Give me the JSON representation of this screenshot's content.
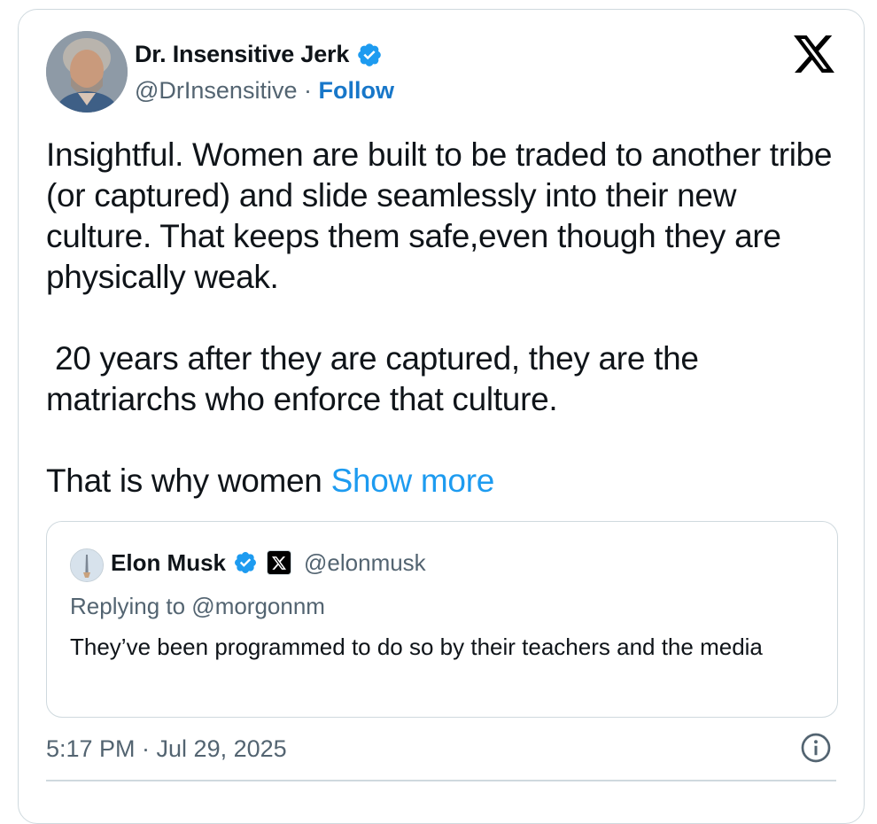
{
  "author": {
    "name": "Dr. Insensitive Jerk",
    "handle": "@DrInsensitive",
    "separator": " · ",
    "follow_label": "Follow",
    "verified_badge_icon": "verified-badge-icon",
    "avatar_icon": "avatar-photo"
  },
  "platform_logo_icon": "x-logo-icon",
  "tweet": {
    "paragraph1": "Insightful. Women are built to be traded to another tribe (or captured) and slide seamlessly into their new culture. That keeps them safe,even though they are physically weak.",
    "paragraph2": " 20 years after they are captured, they are the matriarchs who enforce that culture.",
    "paragraph3": "That is why women ",
    "show_more_label": "Show more"
  },
  "quoted": {
    "name": "Elon Musk",
    "handle": "@elonmusk",
    "replying_to": "Replying to @morgonnm",
    "text": "They’ve been programmed to do so by their teachers and the media"
  },
  "timestamp": "5:17 PM · Jul 29, 2025",
  "colors": {
    "accent": "#1d9bf0",
    "follow": "#1877c9",
    "secondary_text": "#536471",
    "border": "#cfd9de"
  }
}
